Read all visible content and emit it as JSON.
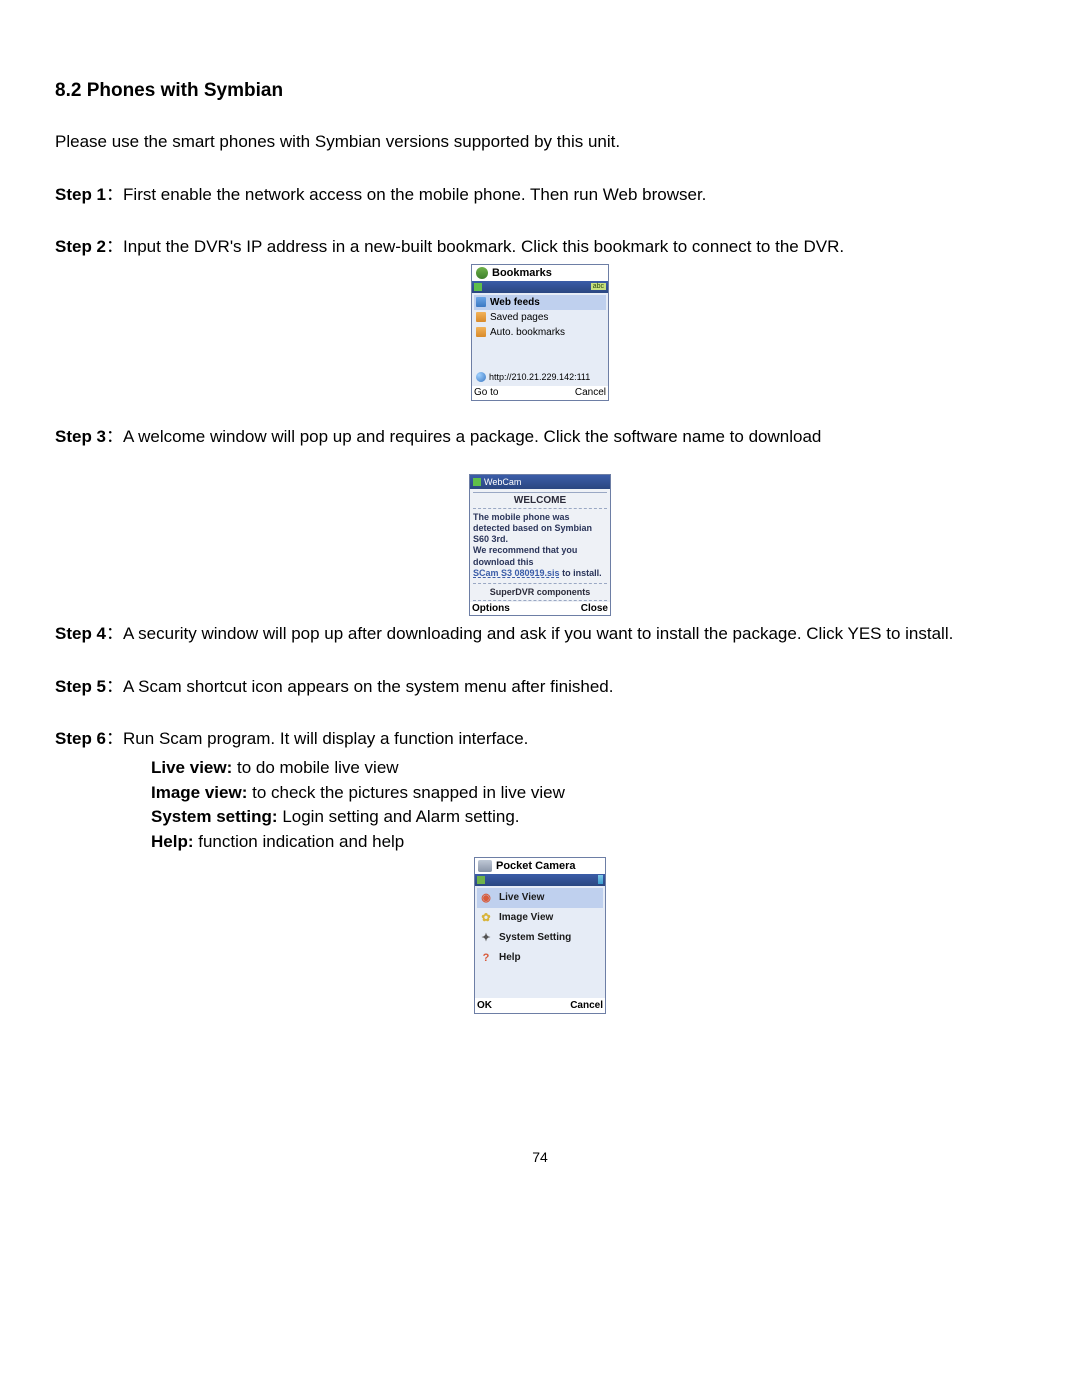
{
  "section_title": "8.2 Phones with Symbian",
  "intro": "Please use the smart phones with Symbian versions supported by this unit.",
  "steps": {
    "s1": {
      "label": "Step 1",
      "sep": "：",
      "text": "First enable the network access on the mobile phone. Then run Web browser."
    },
    "s2": {
      "label": "Step 2",
      "sep": "：",
      "text": "Input the DVR's IP address in a new-built bookmark. Click this bookmark to connect to the DVR."
    },
    "s3": {
      "label": "Step 3",
      "sep": "：",
      "text": "A welcome window will pop up and requires a package. Click the software name to download"
    },
    "s4": {
      "label": "Step 4",
      "sep": "：",
      "text": "A security window will pop up after downloading and ask if you want to install the package. Click YES to install."
    },
    "s5": {
      "label": "Step 5",
      "sep": "：",
      "text": "A Scam shortcut icon appears on the system menu after finished."
    },
    "s6": {
      "label": "Step 6",
      "sep": "：",
      "text": "Run Scam program. It will display a function interface."
    }
  },
  "step6_items": {
    "live": {
      "label": "Live view:",
      "text": " to do mobile live view"
    },
    "image": {
      "label": "Image view:",
      "text": " to check the pictures snapped in live view"
    },
    "system": {
      "label": "System setting:",
      "text": " Login setting and Alarm setting."
    },
    "help": {
      "label": "Help:",
      "text": " function indication and help"
    }
  },
  "shot_bookmarks": {
    "title": "Bookmarks",
    "abc": "abc",
    "items": {
      "webfeeds": "Web feeds",
      "saved": "Saved pages",
      "auto": "Auto. bookmarks"
    },
    "url": "http://210.21.229.142:111",
    "goto": "Go to",
    "cancel": "Cancel"
  },
  "shot_welcome": {
    "header": "WebCam",
    "title": "WELCOME",
    "msg_line1": "The mobile phone was",
    "msg_line2": "detected based on Symbian",
    "msg_line3": "S60 3rd.",
    "msg_line4": "We recommend that you",
    "msg_line5": "download this",
    "link": "SCam S3 080919.sis",
    "link_tail": " to install.",
    "components": "SuperDVR components",
    "options": "Options",
    "close": "Close"
  },
  "shot_pocket": {
    "title": "Pocket Camera",
    "items": {
      "live": "Live View",
      "image": "Image View",
      "setting": "System Setting",
      "help": "Help"
    },
    "ok": "OK",
    "cancel": "Cancel"
  },
  "page_number": "74"
}
